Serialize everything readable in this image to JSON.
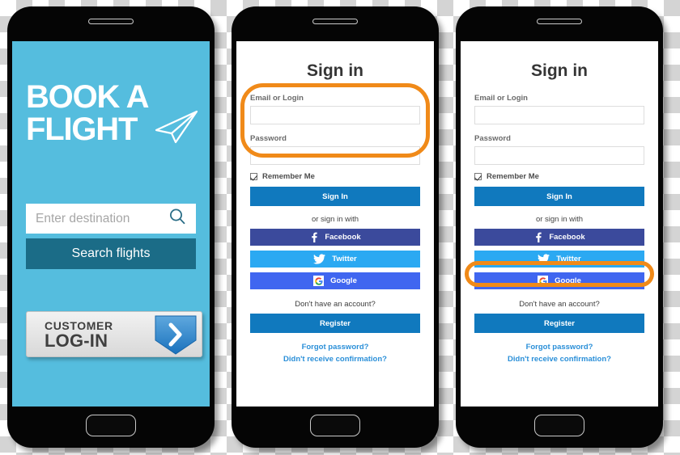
{
  "colors": {
    "promo_bg": "#55bdde",
    "promo_button": "#1b6c87",
    "primary_blue": "#1079be",
    "facebook": "#3b4a9c",
    "twitter": "#2ba9f2",
    "google": "#4066f0",
    "link_blue": "#2a8fd8",
    "highlight_ring": "#f08a19"
  },
  "phones": [
    {
      "id": "promo-phone",
      "screen": "promo",
      "headline_line1": "BOOK A",
      "headline_line2": "FLIGHT",
      "plane_icon": "paper-plane-icon",
      "search": {
        "placeholder": "Enter destination",
        "value": "",
        "icon": "search-icon"
      },
      "search_button_label": "Search flights",
      "customer_login": {
        "line1": "CUSTOMER",
        "line2": "LOG-IN",
        "icon": "chevron-right-icon"
      }
    },
    {
      "id": "signin-phone-fields-highlighted",
      "screen": "signin",
      "highlight": "fields",
      "title": "Sign in",
      "email_label": "Email or Login",
      "email_value": "",
      "password_label": "Password",
      "password_value": "",
      "remember_label": "Remember Me",
      "remember_checked": true,
      "signin_button_label": "Sign In",
      "divider_label": "or sign in with",
      "social": [
        {
          "label": "Facebook",
          "icon": "facebook-icon",
          "color": "#3b4a9c"
        },
        {
          "label": "Twitter",
          "icon": "twitter-icon",
          "color": "#2ba9f2"
        },
        {
          "label": "Google",
          "icon": "google-icon",
          "color": "#4066f0"
        }
      ],
      "account_question": "Don't have an account?",
      "register_button_label": "Register",
      "links": [
        "Forgot password?",
        "Didn't receive confirmation?"
      ]
    },
    {
      "id": "signin-phone-facebook-highlighted",
      "screen": "signin",
      "highlight": "facebook",
      "title": "Sign in",
      "email_label": "Email or Login",
      "email_value": "",
      "password_label": "Password",
      "password_value": "",
      "remember_label": "Remember Me",
      "remember_checked": true,
      "signin_button_label": "Sign In",
      "divider_label": "or sign in with",
      "social": [
        {
          "label": "Facebook",
          "icon": "facebook-icon",
          "color": "#3b4a9c"
        },
        {
          "label": "Twitter",
          "icon": "twitter-icon",
          "color": "#2ba9f2"
        },
        {
          "label": "Google",
          "icon": "google-icon",
          "color": "#4066f0"
        }
      ],
      "account_question": "Don't have an account?",
      "register_button_label": "Register",
      "links": [
        "Forgot password?",
        "Didn't receive confirmation?"
      ]
    }
  ]
}
